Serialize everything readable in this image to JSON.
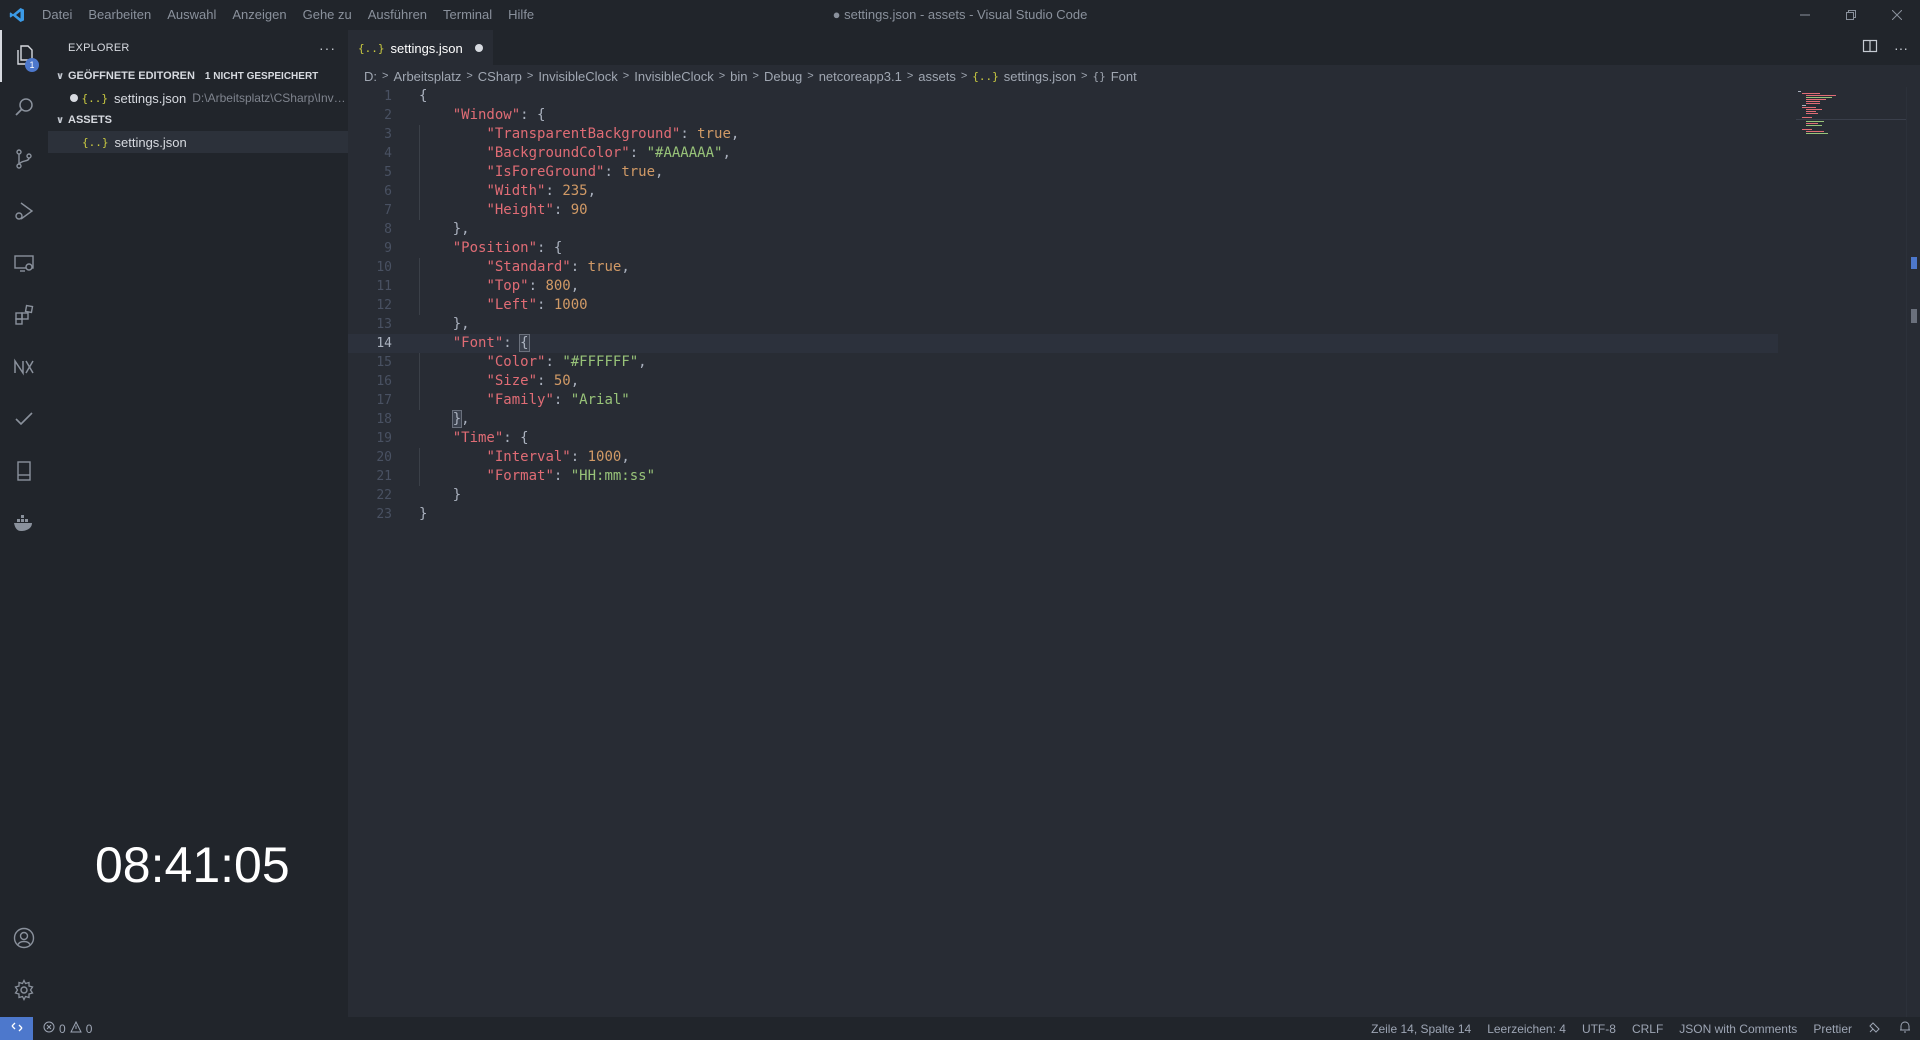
{
  "window": {
    "title": "● settings.json - assets - Visual Studio Code",
    "menu": [
      "Datei",
      "Bearbeiten",
      "Auswahl",
      "Anzeigen",
      "Gehe zu",
      "Ausführen",
      "Terminal",
      "Hilfe"
    ]
  },
  "activity_bar": {
    "explorer_badge": "1",
    "icons": [
      "files-icon",
      "search-icon",
      "source-control-icon",
      "run-debug-icon",
      "remote-explorer-icon",
      "extensions-icon",
      "nx-console-icon",
      "testing-check-icon",
      "bookmark-icon",
      "docker-icon"
    ],
    "bottom_icons": [
      "account-icon",
      "settings-gear-icon"
    ]
  },
  "sidebar": {
    "title": "EXPLORER",
    "open_editors": {
      "label": "GEÖFFNETE EDITOREN",
      "dirty_label": "1 NICHT GESPEICHERT",
      "files": [
        {
          "name": "settings.json",
          "path": "D:\\Arbeitsplatz\\CSharp\\Invisib..."
        }
      ]
    },
    "folder": {
      "label": "ASSETS",
      "files": [
        {
          "name": "settings.json"
        }
      ]
    }
  },
  "overlay_clock": "08:41:05",
  "editor": {
    "tab": {
      "label": "settings.json",
      "dirty": true
    },
    "breadcrumb": [
      "D:",
      "Arbeitsplatz",
      "CSharp",
      "InvisibleClock",
      "InvisibleClock",
      "bin",
      "Debug",
      "netcoreapp3.1",
      "assets",
      "settings.json",
      "Font"
    ],
    "current_line": 14,
    "lines": [
      "{",
      "    \"Window\": {",
      "        \"TransparentBackground\": true,",
      "        \"BackgroundColor\": \"#AAAAAA\",",
      "        \"IsForeGround\": true,",
      "        \"Width\": 235,",
      "        \"Height\": 90",
      "    },",
      "    \"Position\": {",
      "        \"Standard\": true,",
      "        \"Top\": 800,",
      "        \"Left\": 1000",
      "    },",
      "    \"Font\": {",
      "        \"Color\": \"#FFFFFF\",",
      "        \"Size\": 50,",
      "        \"Family\": \"Arial\"",
      "    },",
      "    \"Time\": {",
      "        \"Interval\": 1000,",
      "        \"Format\": \"HH:mm:ss\"",
      "    }",
      "}"
    ]
  },
  "status_bar": {
    "errors": "0",
    "warnings": "0",
    "position": "Zeile 14, Spalte 14",
    "indent": "Leerzeichen: 4",
    "encoding": "UTF-8",
    "eol": "CRLF",
    "language": "JSON with Comments",
    "formatter": "Prettier"
  },
  "colors": {
    "accent": "#4d78cc",
    "key": "#e06c75",
    "string": "#98c379",
    "number": "#d19a66"
  }
}
